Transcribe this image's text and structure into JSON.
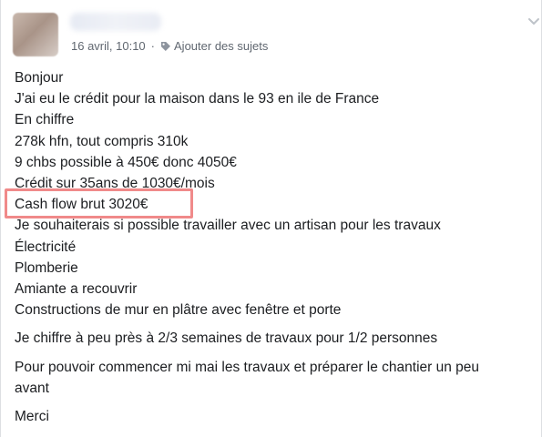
{
  "post": {
    "author_name": "",
    "timestamp": "16 avril, 10:10",
    "separator": "·",
    "add_topics_label": "Ajouter des sujets",
    "paragraphs": [
      {
        "lines": [
          "Bonjour",
          "J'ai eu le crédit pour la maison dans le 93 en ile de France",
          "En chiffre",
          "278k hfn, tout compris 310k",
          "9 chbs possible à 450€ donc 4050€",
          "Crédit sur 35ans de 1030€/mois",
          "Cash flow brut 3020€",
          "Je souhaiterais si possible travailler avec un artisan pour les travaux",
          "Électricité",
          "Plomberie",
          "Amiante a recouvrir",
          "Constructions de mur en plâtre avec fenêtre et porte"
        ]
      },
      {
        "lines": [
          "Je chiffre à peu près à 2/3 semaines de travaux pour 1/2 personnes"
        ]
      },
      {
        "lines": [
          "Pour pouvoir commencer mi mai les travaux et préparer le chantier un peu",
          "avant"
        ]
      },
      {
        "lines": [
          "Merci"
        ]
      }
    ],
    "highlight_color": "#f08a8a"
  },
  "icons": {
    "tag": "tag-icon",
    "options": "chevron-down-icon"
  }
}
